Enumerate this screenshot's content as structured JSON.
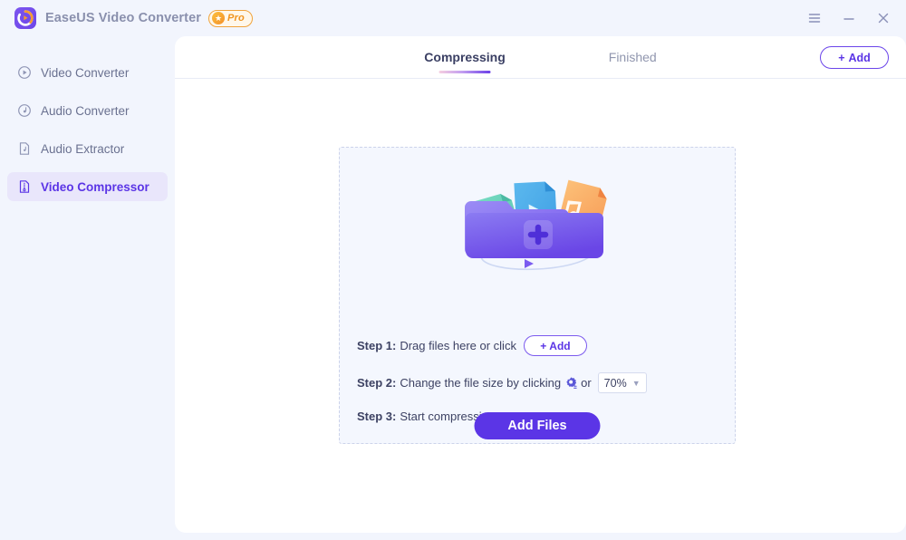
{
  "window": {
    "app_title": "EaseUS Video Converter",
    "pro_badge": "Pro",
    "star_glyph": "★",
    "controls": {
      "menu": "menu-icon",
      "minimize": "minimize-icon",
      "close": "close-icon"
    }
  },
  "sidebar": {
    "items": [
      {
        "label": "Video Converter",
        "icon": "video-converter-icon",
        "active": false
      },
      {
        "label": "Audio Converter",
        "icon": "audio-converter-icon",
        "active": false
      },
      {
        "label": "Audio Extractor",
        "icon": "audio-extractor-icon",
        "active": false
      },
      {
        "label": "Video Compressor",
        "icon": "video-compressor-icon",
        "active": true
      }
    ]
  },
  "tabs": {
    "compressing": "Compressing",
    "finished": "Finished",
    "active": "Compressing"
  },
  "toolbar": {
    "add_label": "Add",
    "plus_glyph": "+"
  },
  "dropzone": {
    "illustration": "folder-with-files-illustration",
    "steps": [
      {
        "label": "Step 1:",
        "text_before": "Drag files here or click",
        "control": "add-button",
        "text_after": ""
      },
      {
        "label": "Step 2:",
        "text_before": "Change the file size by clicking",
        "control": "gear-and-ratio",
        "text_after": "or"
      },
      {
        "label": "Step 3:",
        "text_before": "Start compression",
        "control": "",
        "text_after": ""
      }
    ],
    "inline_add_label": "Add",
    "gear_icon": "settings-gear-icon",
    "or_text": "or",
    "ratio_value": "70%",
    "ratio_chevron": "▼",
    "add_files_label": "Add Files"
  },
  "colors": {
    "accent": "#5b35e6",
    "accent_light": "#e9e6fb",
    "app_bg": "#f2f5fd",
    "panel_bg": "#ffffff",
    "dropzone_bg": "#f4f7fe",
    "dashed_border": "#ccd3ea",
    "pro_orange": "#f0941f",
    "muted_text": "#8a90ad"
  }
}
